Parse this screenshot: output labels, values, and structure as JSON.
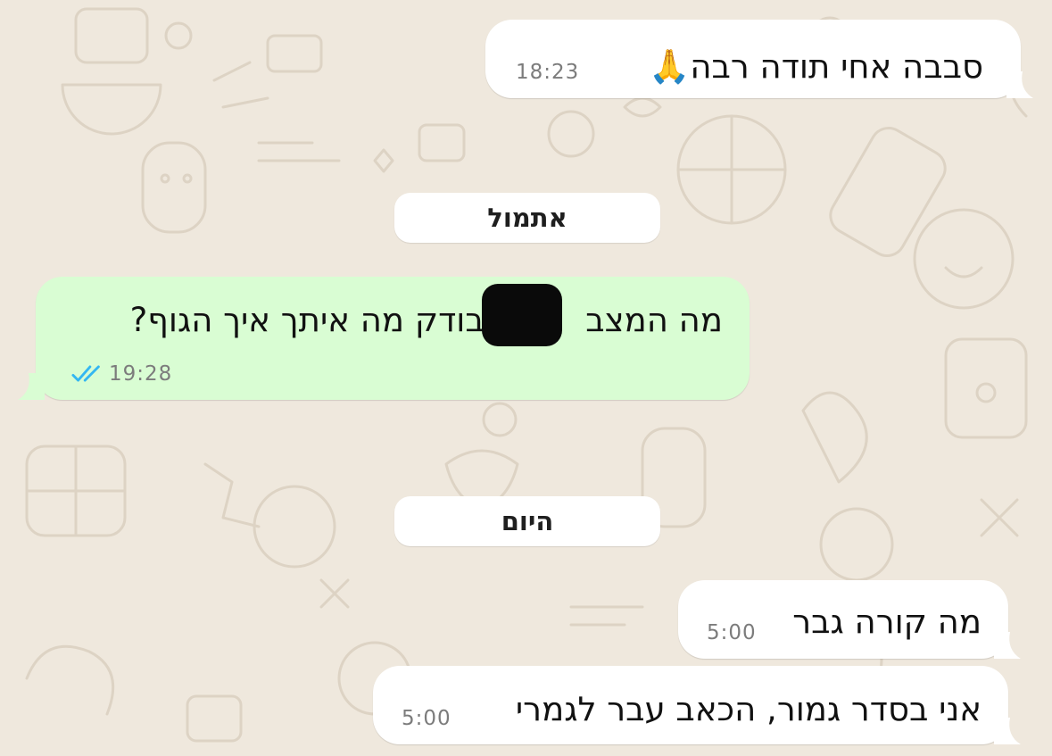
{
  "colors": {
    "wallpaper": "#efe8dd",
    "incoming_bubble": "#ffffff",
    "outgoing_bubble": "#d9fdd3",
    "read_ticks": "#34b7f1"
  },
  "messages": [
    {
      "direction": "incoming",
      "text": "סבבה אחי תודה רבה",
      "emoji": "🙏",
      "time": "18:23"
    },
    {
      "direction": "outgoing",
      "text_before": "מה המצב",
      "text_after": ", בודק מה איתך איך הגוף?",
      "time": "19:28",
      "status_icon": "double-check-icon"
    },
    {
      "direction": "incoming",
      "text": "מה קורה גבר",
      "time": "5:00"
    },
    {
      "direction": "incoming",
      "text": "אני בסדר גמור, הכאב עבר לגמרי",
      "time": "5:00"
    }
  ],
  "day_separators": [
    "אתמול",
    "היום"
  ]
}
